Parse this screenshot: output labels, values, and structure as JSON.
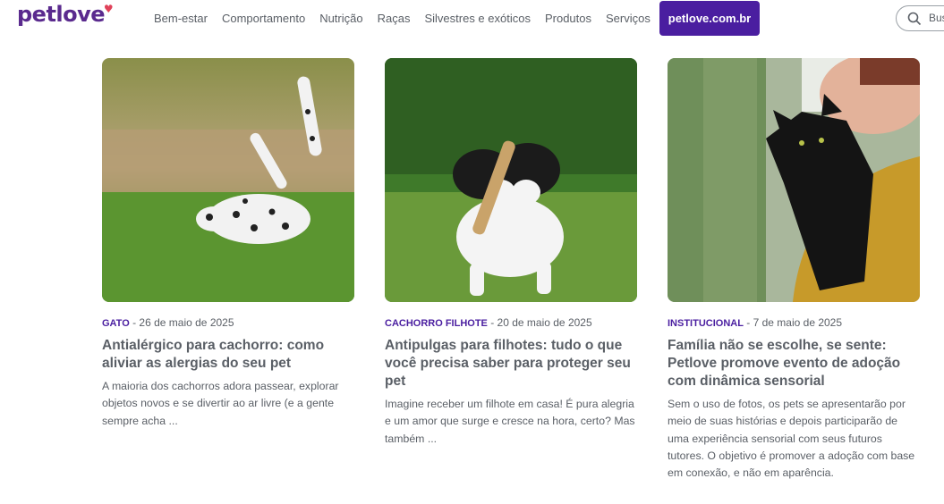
{
  "header": {
    "logo": "petlove",
    "nav": [
      "Bem-estar",
      "Comportamento",
      "Nutrição",
      "Raças",
      "Silvestres e exóticos",
      "Produtos",
      "Serviços"
    ],
    "cta": "petlove.com.br",
    "search_label": "Bus"
  },
  "cards": [
    {
      "category": "GATO",
      "date": " - 26 de maio de 2025",
      "title": "Antialérgico para cachorro: como aliviar as alergias do seu pet",
      "excerpt": "A maioria dos cachorros adora passear, explorar objetos novos e se divertir ao ar livre (e a gente sempre acha ..."
    },
    {
      "category": "CACHORRO FILHOTE",
      "date": " - 20 de maio de 2025",
      "title": "Antipulgas para filhotes: tudo o que você precisa saber para proteger seu pet",
      "excerpt": "Imagine receber um filhote em casa! É pura alegria e um amor que surge e cresce na hora, certo?  Mas também ..."
    },
    {
      "category": "INSTITUCIONAL",
      "date": " - 7 de maio de 2025",
      "title": "Família não se escolhe, se sente: Petlove promove evento de adoção com dinâmica sensorial",
      "excerpt": "Sem o uso de fotos, os pets se apresentarão por meio de suas histórias e depois participarão de uma experiência sensorial com seus futuros tutores. O objetivo é promover a adoção com base em conexão, e não em aparência."
    }
  ],
  "colors": {
    "brand": "#4a1ea0",
    "logo": "#5a2a8e",
    "heart": "#e0425a"
  },
  "icons": {
    "search": "search-icon",
    "logo_heart": "heart-icon"
  }
}
